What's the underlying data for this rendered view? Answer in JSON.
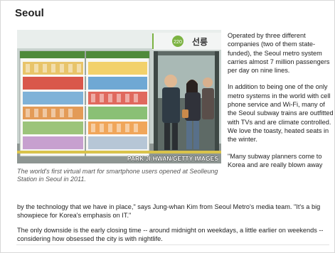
{
  "article": {
    "heading": "Seoul",
    "photo_credit": "PARK JI-HWAN/GETTY IMAGES",
    "photo_caption": "The world's first virtual mart for smartphone users opened at Seolleung Station in Seoul in 2011.",
    "station_sign_number": "220",
    "station_sign_name": "선릉",
    "paragraph_1": "Operated by three different companies (two of them state-funded), the Seoul metro system carries almost 7 million passengers per day on nine lines.",
    "paragraph_2": "In addition to being one of the only metro systems in the world with cell phone service and Wi-Fi, many of the Seoul subway trains are outfitted with TVs and are climate controlled. We love the toasty, heated seats in the winter.",
    "paragraph_3a": "\"Many subway planners come to Korea and are really blown away",
    "paragraph_3b": "by the technology that we have in place,\" says Jung-whan Kim from Seoul Metro's media team. \"It's a big showpiece for Korea's emphasis on IT.\"",
    "paragraph_4": "The only downside is the early closing time -- around midnight on weekdays, a little earlier on weekends -- considering how obsessed the city is with nightlife."
  }
}
